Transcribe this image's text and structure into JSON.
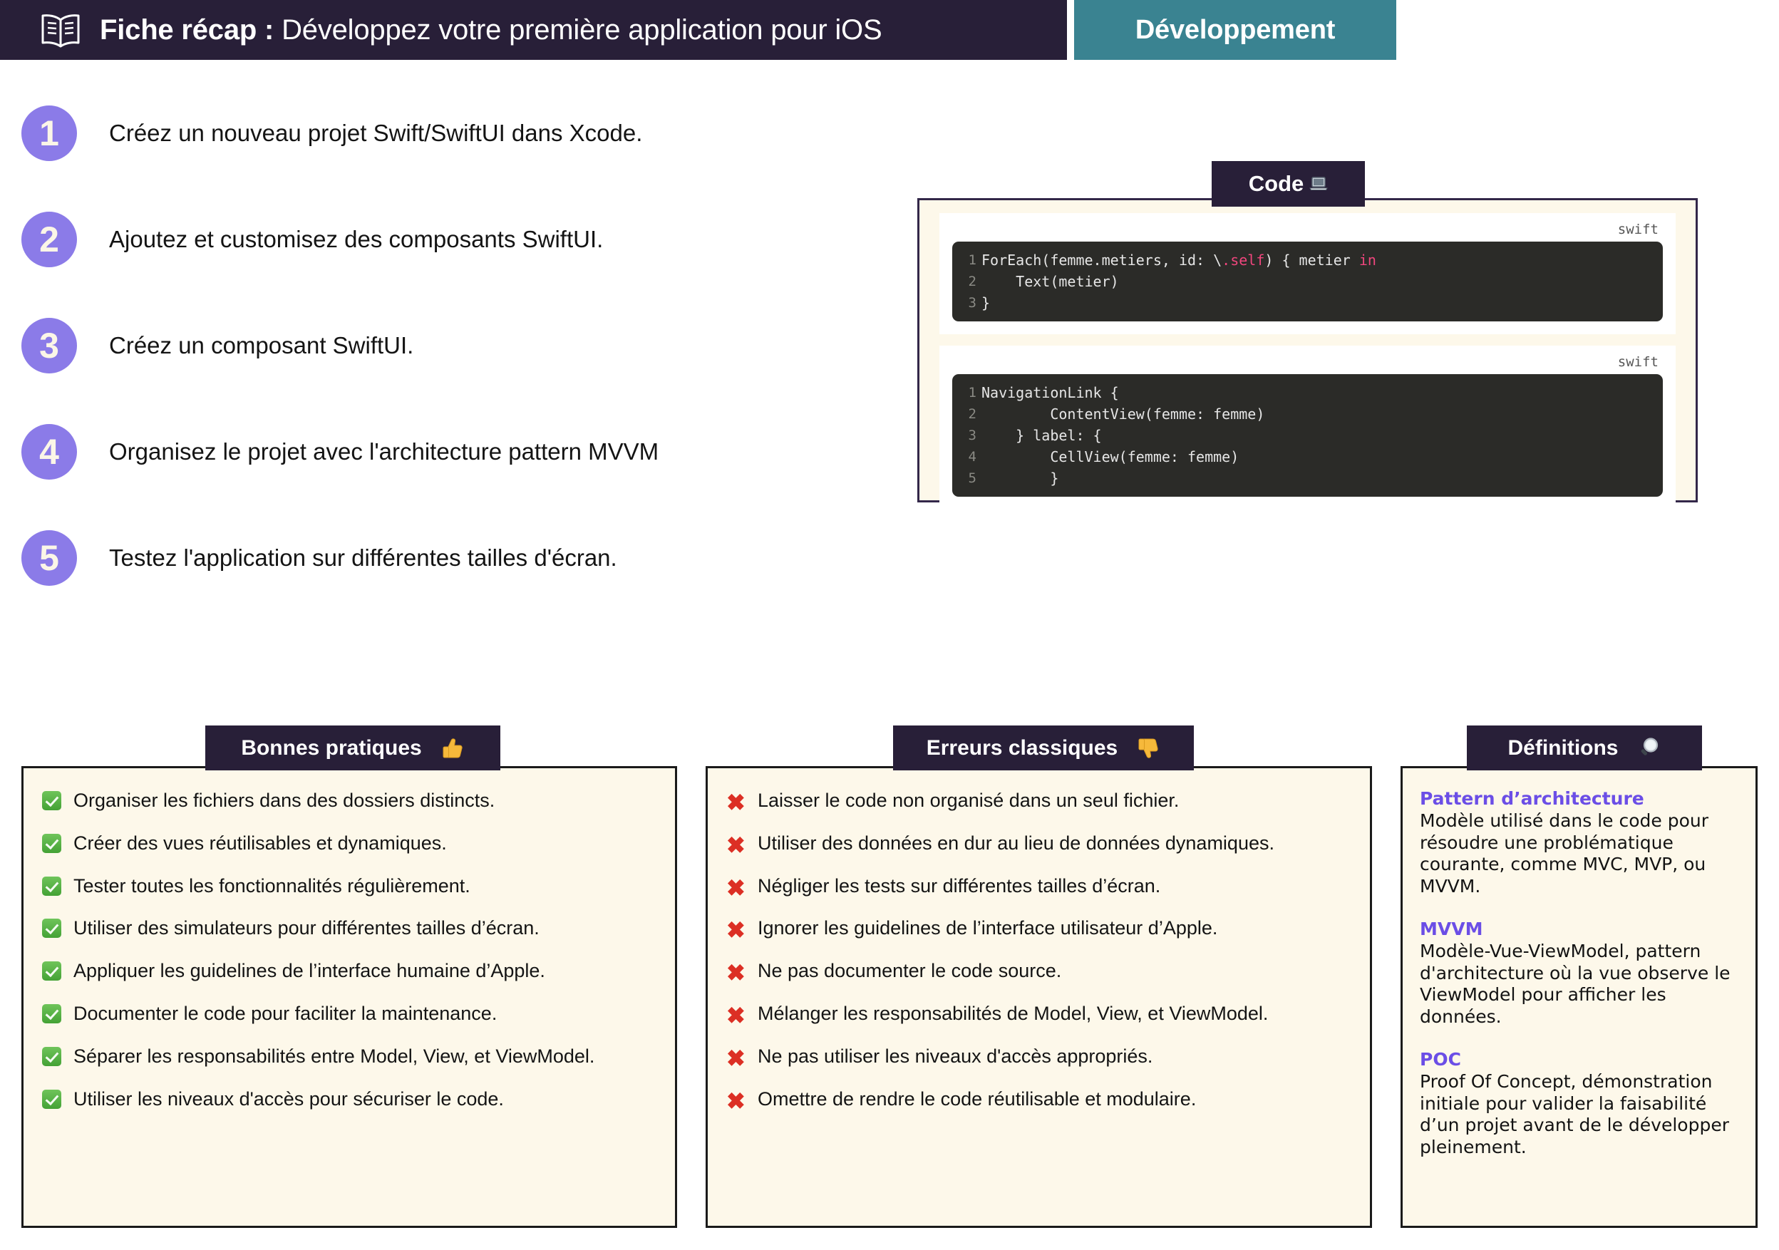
{
  "header": {
    "icon": "open-book-icon",
    "title_strong": "Fiche récap :",
    "title_rest": " Développez votre première application pour iOS",
    "category_badge": "Développement",
    "bar_color": "#281F38",
    "badge_color": "#3A8391"
  },
  "steps": [
    {
      "number": "1",
      "text": "Créez un nouveau projet Swift/SwiftUI dans Xcode."
    },
    {
      "number": "2",
      "text": "Ajoutez et customisez des composants SwiftUI."
    },
    {
      "number": "3",
      "text": "Créez un composant SwiftUI."
    },
    {
      "number": "4",
      "text": "Organisez le projet avec l'architecture pattern MVVM"
    },
    {
      "number": "5",
      "text": "Testez l'application sur différentes tailles d'écran."
    }
  ],
  "code_section": {
    "tab_label": "Code",
    "tab_icon": "laptop-icon",
    "blocks": [
      {
        "language": "swift",
        "lines": [
          {
            "n": "1",
            "indent": 0,
            "pre": "ForEach(femme.metiers, id: \\",
            "kw1": ".self",
            "mid": ") { metier ",
            "kw2": "in",
            "post": ""
          },
          {
            "n": "2",
            "indent": 0,
            "pre": "    Text(metier)",
            "kw1": "",
            "mid": "",
            "kw2": "",
            "post": ""
          },
          {
            "n": "3",
            "indent": 0,
            "pre": "}",
            "kw1": "",
            "mid": "",
            "kw2": "",
            "post": ""
          }
        ]
      },
      {
        "language": "swift",
        "lines": [
          {
            "n": "1",
            "indent": 0,
            "pre": "NavigationLink {",
            "kw1": "",
            "mid": "",
            "kw2": "",
            "post": ""
          },
          {
            "n": "2",
            "indent": 4,
            "pre": "        ContentView(femme: femme)",
            "kw1": "",
            "mid": "",
            "kw2": "",
            "post": ""
          },
          {
            "n": "3",
            "indent": 4,
            "pre": "    } label: {",
            "kw1": "",
            "mid": "",
            "kw2": "",
            "post": ""
          },
          {
            "n": "4",
            "indent": 4,
            "pre": "        CellView(femme: femme)",
            "kw1": "",
            "mid": "",
            "kw2": "",
            "post": ""
          },
          {
            "n": "5",
            "indent": 4,
            "pre": "        }",
            "kw1": "",
            "mid": "",
            "kw2": "",
            "post": ""
          }
        ]
      }
    ]
  },
  "good_practices": {
    "tab_label": "Bonnes pratiques",
    "tab_icon": "thumbs-up-icon",
    "items": [
      "Organiser les fichiers dans des dossiers distincts.",
      "Créer des vues réutilisables et dynamiques.",
      "Tester toutes les fonctionnalités régulièrement.",
      "Utiliser des simulateurs pour différentes tailles d’écran.",
      "Appliquer les guidelines de l’interface humaine d’Apple.",
      "Documenter le code pour faciliter la maintenance.",
      "Séparer les responsabilités entre Model, View, et ViewModel.",
      "Utiliser les niveaux d'accès pour sécuriser le code."
    ]
  },
  "classic_errors": {
    "tab_label": "Erreurs classiques",
    "tab_icon": "thumbs-down-icon",
    "items": [
      "Laisser le code non organisé dans un seul fichier.",
      "Utiliser des données en dur au lieu de données dynamiques.",
      "Négliger les tests sur différentes tailles d’écran.",
      "Ignorer les guidelines de l’interface utilisateur d’Apple.",
      "Ne pas documenter le code source.",
      "Mélanger les responsabilités de Model, View, et ViewModel.",
      "Ne pas utiliser les niveaux d'accès appropriés.",
      "Omettre de rendre le code réutilisable et modulaire."
    ]
  },
  "definitions": {
    "tab_label": "Définitions",
    "tab_icon": "magnifying-glass-icon",
    "entries": [
      {
        "term": "Pattern d’architecture",
        "description": "Modèle utilisé dans le code pour résoudre une problématique courante, comme MVC, MVP, ou MVVM."
      },
      {
        "term": "MVVM",
        "description": "Modèle-Vue-ViewModel, pattern d'architecture où la vue observe le ViewModel pour afficher les données."
      },
      {
        "term": "POC",
        "description": "Proof Of Concept, démonstration initiale pour valider la faisabilité d’un projet avant de le développer pleinement."
      }
    ]
  },
  "colors": {
    "dark": "#281F38",
    "teal": "#3A8391",
    "purple": "#8B7BE8",
    "cream": "#FDF8EA",
    "accent_violet": "#6B4EE6",
    "error_red": "#DC2F24",
    "code_bg": "#2B2B28"
  }
}
